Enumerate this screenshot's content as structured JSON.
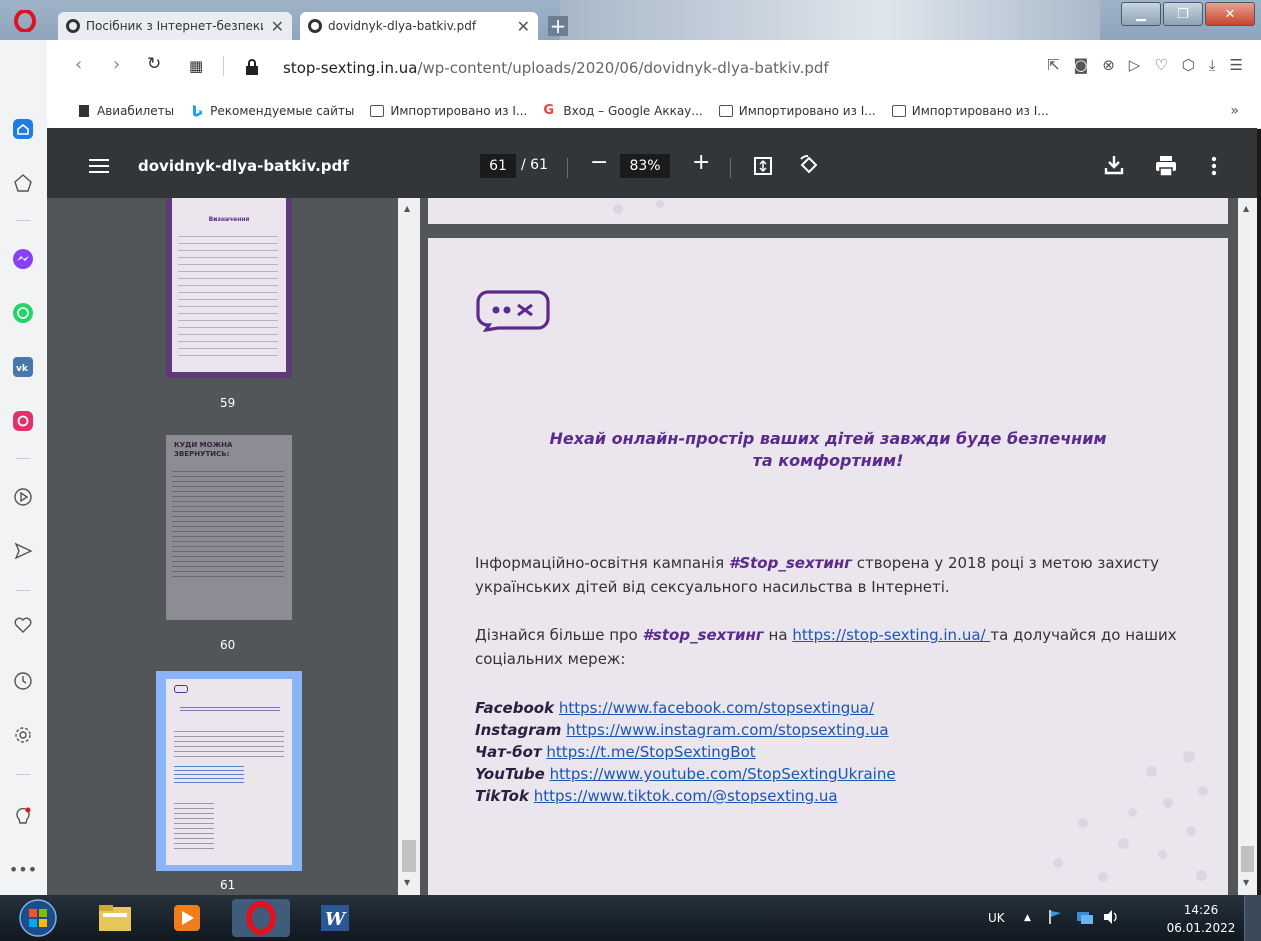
{
  "tabs": [
    {
      "label": "Посібник з Інтернет-безпеки",
      "active": false
    },
    {
      "label": "dovidnyk-dlya-batkiv.pdf",
      "active": true
    }
  ],
  "address": {
    "host": "stop-sexting.in.ua",
    "path": "/wp-content/uploads/2020/06/dovidnyk-dlya-batkiv.pdf"
  },
  "bookmarks": [
    {
      "label": "Авиабилеты",
      "icon": "document-icon"
    },
    {
      "label": "Рекомендуемые сайты",
      "icon": "bing-icon"
    },
    {
      "label": "Импортировано из I...",
      "icon": "folder-icon"
    },
    {
      "label": "Вход – Google Аккау...",
      "icon": "google-icon"
    },
    {
      "label": "Импортировано из I...",
      "icon": "folder-icon"
    },
    {
      "label": "Импортировано из I...",
      "icon": "folder-icon"
    }
  ],
  "bookmarks_more": "»",
  "pdf": {
    "title": "dovidnyk-dlya-batkiv.pdf",
    "page_current": "61",
    "page_total": "/ 61",
    "zoom": "83%"
  },
  "thumbnails": [
    {
      "number": "59",
      "heading": "Визначення"
    },
    {
      "number": "60",
      "heading": "КУДИ МОЖНА ЗВЕРНУТИСЬ:"
    },
    {
      "number": "61",
      "heading": ""
    }
  ],
  "page": {
    "slogan_line1": "Нехай онлайн-простір ваших дітей завжди буде безпечним",
    "slogan_line2": "та комфортним!",
    "p1_a": "Інформаційно-освітня кампанія ",
    "p1_hash": "#Stop_sexтинг",
    "p1_b": " створена у 2018 році з метою захисту українських дітей від сексуального насильства в Інтернеті.",
    "p2_a": "Дізнайся більше про ",
    "p2_hash": "#stop_sexтинг",
    "p2_b": " на ",
    "p2_link": " https://stop-sexting.in.ua/ ",
    "p2_c": "та долучайся до наших соціальних мереж:",
    "socials": [
      {
        "name": "Facebook",
        "url": "https://www.facebook.com/stopsextingua/"
      },
      {
        "name": "Instagram",
        "url": "https://www.instagram.com/stopsexting.ua"
      },
      {
        "name": "Чат-бот",
        "url": "https://t.me/StopSextingBot"
      },
      {
        "name": "YouTube",
        "url": "https://www.youtube.com/StopSextingUkraine"
      },
      {
        "name": "TikTok",
        "url": "https://www.tiktok.com/@stopsexting.ua"
      }
    ]
  },
  "tray": {
    "language": "UK",
    "time": "14:26",
    "date": "06.01.2022"
  }
}
